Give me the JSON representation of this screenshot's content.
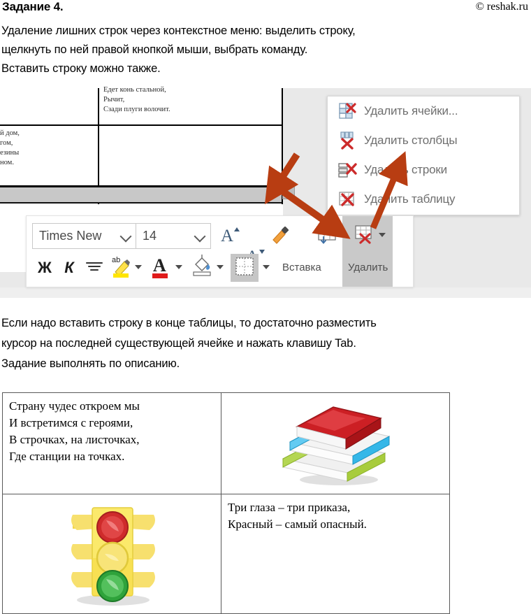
{
  "header": {
    "task_title": "Задание 4.",
    "copyright": "© reshak.ru"
  },
  "intro_paragraph": {
    "lines": [
      "Удаление лишних строк через контекстное меню: выделить строку,",
      "щелкнуть по ней правой кнопкой мыши, выбрать команду.",
      "Вставить строку можно также."
    ]
  },
  "screenshot": {
    "document_fragment": {
      "right_cell_lines": [
        "Едет конь стальной,",
        "Рычит,",
        "Сзади плуги волочит."
      ],
      "left_cell_lines": [
        "й дом,",
        "гом,",
        "езины",
        "ном."
      ]
    },
    "context_menu": {
      "items": [
        {
          "label": "Удалить ячейки...",
          "icon": "delete-cells-icon"
        },
        {
          "label": "Удалить столбцы",
          "icon": "delete-columns-icon"
        },
        {
          "label": "Удалить строки",
          "icon": "delete-rows-icon"
        },
        {
          "label": "Удалить таблицу",
          "icon": "delete-table-icon"
        }
      ]
    },
    "ribbon": {
      "font_name": "Times New",
      "font_size": "14",
      "grow_font_label": "A",
      "shrink_font_label": "A",
      "bold_label": "Ж",
      "italic_label": "К",
      "insert_group_label": "Вставка",
      "delete_group_label": "Удалить"
    },
    "colors": {
      "arrow": "#b83d12",
      "menu_text": "#6f6f6f",
      "highlight_yellow": "#ffe500",
      "font_color_red": "#e01b1b",
      "panel_gray": "#e9e9e9",
      "active_gray": "#c9c9c9"
    }
  },
  "middle_paragraph": {
    "lines": [
      "Если надо вставить строку в конце таблицы, то достаточно разместить",
      "курсор на последней существующей ячейке и нажать клавишу Tab.",
      "Задание выполнять по описанию."
    ]
  },
  "poem_table": {
    "rows": [
      {
        "left": {
          "type": "text",
          "lines": [
            "Страну чудес откроем мы",
            "И встретимся с героями,",
            "В строчках, на листочках,",
            "Где станции на точках."
          ]
        },
        "right": {
          "type": "image",
          "name": "stack-of-books-image"
        }
      },
      {
        "left": {
          "type": "image",
          "name": "traffic-light-image"
        },
        "right": {
          "type": "text",
          "lines": [
            "Три глаза – три приказа,",
            "Красный – самый опасный."
          ]
        }
      }
    ]
  }
}
